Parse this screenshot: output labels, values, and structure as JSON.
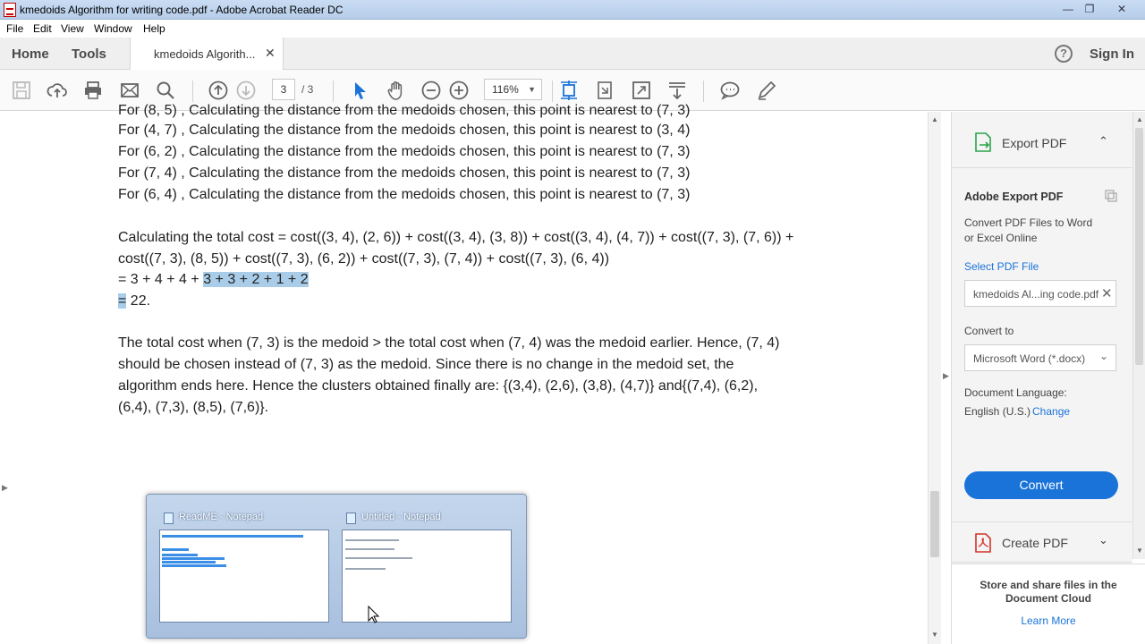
{
  "window": {
    "title": "kmedoids Algorithm for writing code.pdf - Adobe Acrobat Reader DC",
    "controls": [
      "minimize-icon",
      "restore-icon",
      "close-icon"
    ]
  },
  "menu": [
    "File",
    "Edit",
    "View",
    "Window",
    "Help"
  ],
  "tabs": {
    "home": "Home",
    "tools": "Tools",
    "document": "kmedoids Algorith...",
    "close": "✕",
    "help": "?",
    "sign_in": "Sign In"
  },
  "toolbar": {
    "page_current": "3",
    "page_total": "/ 3",
    "zoom": "116%",
    "icons": [
      "save-icon",
      "upload-icon",
      "print-icon",
      "email-icon",
      "search-icon",
      "page-up-icon",
      "page-down-icon",
      "select-arrow-icon",
      "hand-icon",
      "zoom-out-icon",
      "zoom-in-icon",
      "fit-page-icon",
      "rotate-icon",
      "fullscreen-icon",
      "scroll-mode-icon",
      "comment-icon",
      "pen-icon"
    ]
  },
  "document": {
    "lines": [
      "For (8, 5) ,  Calculating the distance from the medoids chosen, this point is nearest to (7, 3)",
      "For (4, 7) ,  Calculating the distance from the medoids chosen, this point is nearest to (3, 4)",
      "For (6, 2) ,  Calculating the distance from the medoids chosen, this point is nearest to (7, 3)",
      "For (7, 4) ,  Calculating the distance from the medoids chosen, this point is nearest to (7, 3)",
      "For (6, 4) ,  Calculating the distance from the medoids chosen, this point is nearest to (7, 3)",
      "Calculating the total cost = cost((3, 4), (2, 6)) + cost((3, 4), (3, 8)) + cost((3, 4), (4, 7)) + cost((7, 3), (7, 6)) +",
      "cost((7, 3), (8, 5)) + cost((7, 3), (6, 2)) + cost((7, 3), (7, 4)) + cost((7, 3), (6, 4))"
    ],
    "sum_prefix": "= 3 + 4 + 4 + ",
    "sum_highlight": "3 + 3 + 2 + 1 + 2",
    "result_eq": "=",
    "result_val": " 22.",
    "conclusion": [
      "The total cost when (7, 3) is the medoid > the total cost when (7, 4) was the medoid earlier. Hence, (7, 4)",
      "should be chosen instead of (7, 3) as the medoid. Since there is no change in the medoid set, the",
      "algorithm ends here. Hence the clusters obtained finally are: {(3,4), (2,6), (3,8), (4,7)} and{(7,4), (6,2),",
      "(6,4), (7,3), (8,5), (7,6)}."
    ]
  },
  "right_pane": {
    "export_title": "Export PDF",
    "adobe_export": "Adobe Export PDF",
    "desc_1": "Convert PDF Files to Word",
    "desc_2": "or Excel Online",
    "select_file": "Select PDF File",
    "file_name": "kmedoids Al...ing code.pdf",
    "convert_to_label": "Convert to",
    "convert_to_value": "Microsoft Word (*.docx)",
    "doc_language_label": "Document Language:",
    "doc_language_value": "English (U.S.)",
    "change": "Change",
    "convert_button": "Convert",
    "create_pdf": "Create PDF",
    "cloud_1": "Store and share files in the",
    "cloud_2": "Document Cloud",
    "learn_more": "Learn More"
  },
  "taskbar_preview": {
    "windows": [
      {
        "title": "ReadME - Notepad"
      },
      {
        "title": "Untitled - Notepad"
      }
    ]
  },
  "colors": {
    "accent": "#1a73d9",
    "highlight": "#a9cde8",
    "link": "#1a73d9"
  }
}
